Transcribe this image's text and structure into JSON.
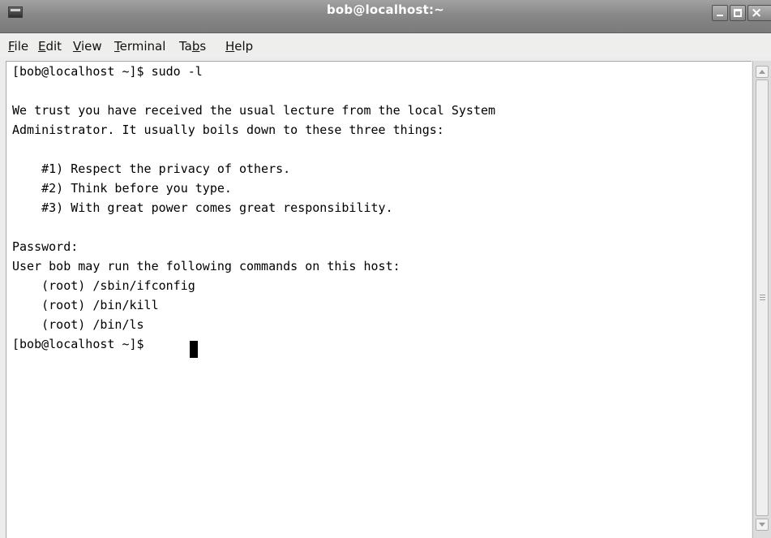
{
  "window": {
    "title": "bob@localhost:~",
    "icon": "terminal-icon",
    "controls": [
      "minimize-icon",
      "maximize-icon",
      "close-icon"
    ]
  },
  "menubar": {
    "items": [
      {
        "label": "File",
        "mnemonic": "F",
        "rest": "ile"
      },
      {
        "label": "Edit",
        "mnemonic": "E",
        "rest": "dit"
      },
      {
        "label": "View",
        "mnemonic": "V",
        "rest": "iew"
      },
      {
        "label": "Terminal",
        "mnemonic": "T",
        "rest": "erminal"
      },
      {
        "label": "Tabs",
        "pre": "Ta",
        "mnemonic": "b",
        "rest": "s"
      },
      {
        "label": "Help",
        "mnemonic": "H",
        "rest": "elp"
      }
    ]
  },
  "terminal": {
    "lines": [
      "[bob@localhost ~]$ sudo -l",
      "",
      "We trust you have received the usual lecture from the local System",
      "Administrator. It usually boils down to these three things:",
      "",
      "    #1) Respect the privacy of others.",
      "    #2) Think before you type.",
      "    #3) With great power comes great responsibility.",
      "",
      "Password:",
      "User bob may run the following commands on this host:",
      "    (root) /sbin/ifconfig",
      "    (root) /bin/kill",
      "    (root) /bin/ls",
      "[bob@localhost ~]$ "
    ]
  }
}
